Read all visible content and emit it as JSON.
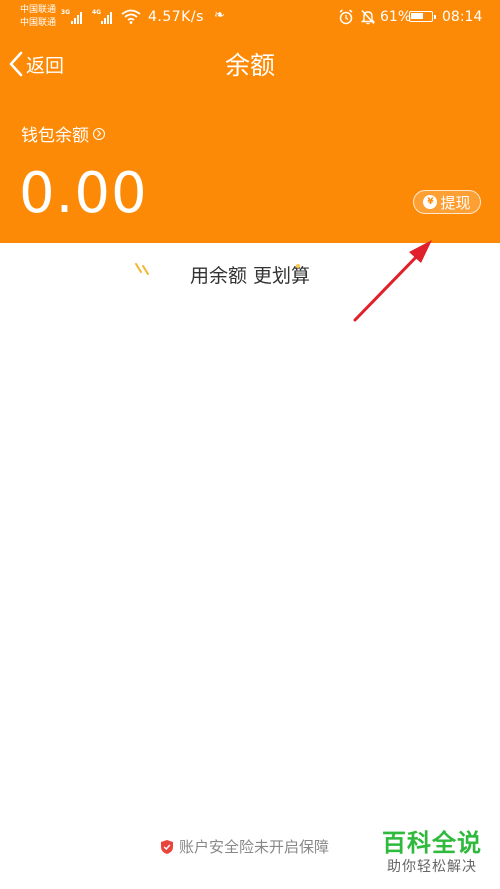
{
  "status_bar": {
    "carrier_1": "中国联通",
    "carrier_2": "中国联通",
    "net_1": "3G",
    "net_2": "4G",
    "speed": "4.57K/s",
    "battery_percent": "61%",
    "battery_level": 0.61,
    "time": "08:14"
  },
  "nav": {
    "back_label": "返回",
    "title": "余额"
  },
  "wallet": {
    "balance_label": "钱包余额",
    "balance_amount": "0.00",
    "withdraw_label": "提现"
  },
  "promo": {
    "text": "用余额 更划算"
  },
  "footer": {
    "security_text": "账户安全险未开启保障"
  },
  "watermark": {
    "title": "百科全说",
    "subtitle": "助你轻松解决"
  },
  "colors": {
    "header_bg": "#fd8a06",
    "annotation_arrow": "#e0202a",
    "shield": "#e8453c",
    "watermark_green": "#2fba3d"
  },
  "icons": {
    "back": "chevron-left-icon",
    "info": "chevron-right-circle-icon",
    "withdraw": "yen-icon",
    "security": "shield-icon"
  }
}
